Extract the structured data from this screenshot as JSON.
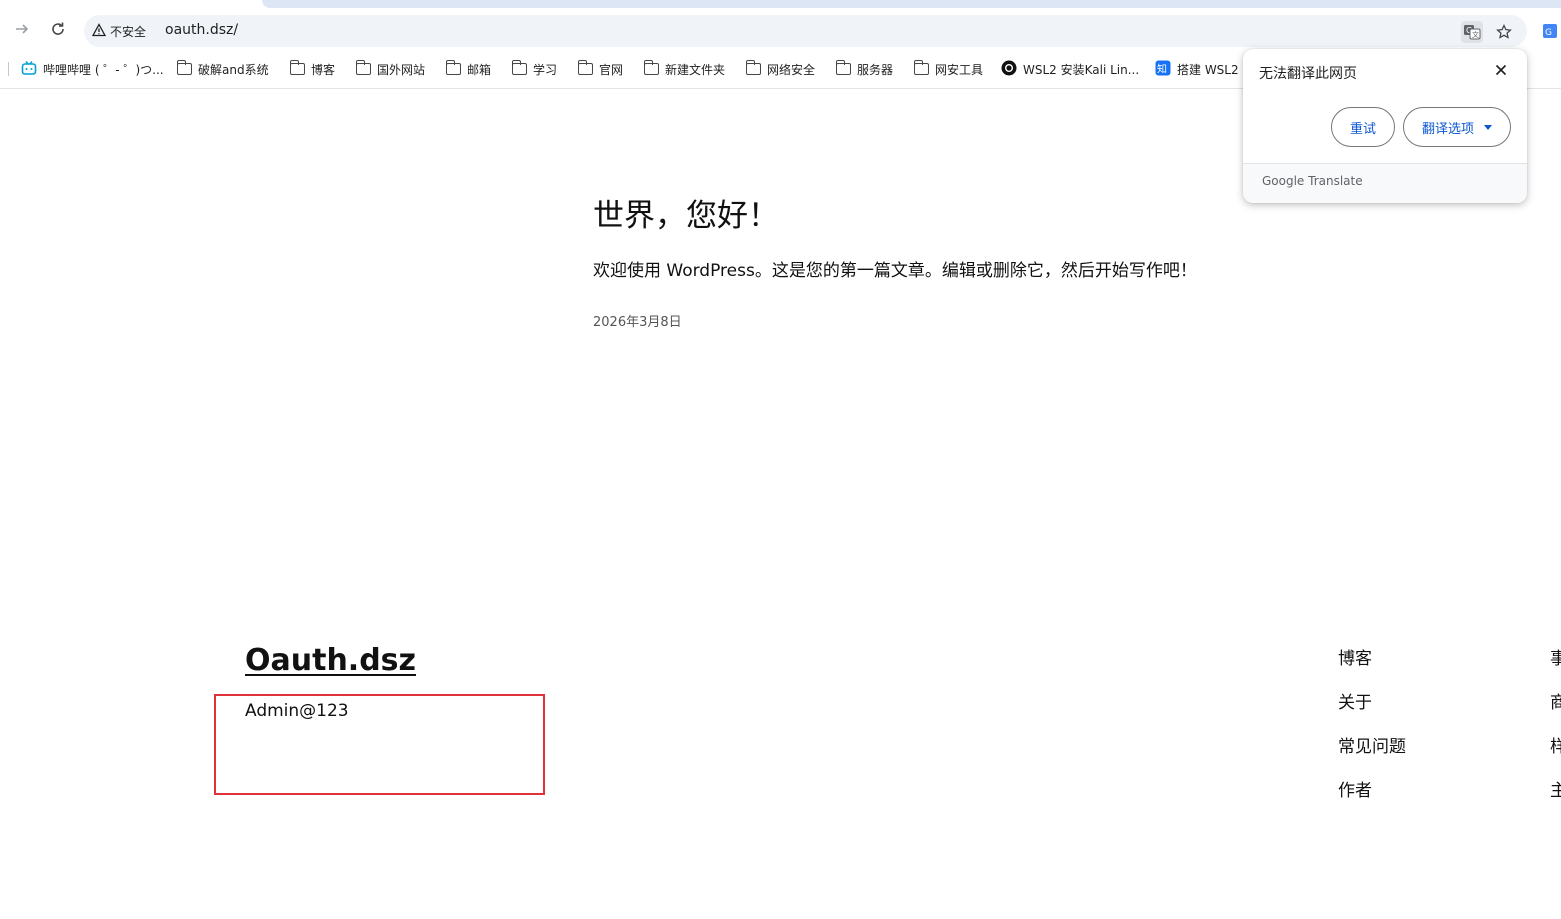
{
  "browser": {
    "security_label": "不安全",
    "url": "oauth.dsz/",
    "icons": {
      "forward": "arrow-right-icon",
      "reload": "reload-icon",
      "warning": "warning-triangle-icon",
      "translate": "translate-icon",
      "star": "star-icon"
    },
    "colors": {
      "omnibox_bg": "#f0f4f9",
      "accent_blue": "#0b57d0"
    }
  },
  "bookmarks": [
    {
      "label": "哔哩哔哩 ( ゜- ゜)つ...",
      "icon": "bilibili-icon"
    },
    {
      "label": "破解and系统",
      "icon": "folder-icon"
    },
    {
      "label": "博客",
      "icon": "folder-icon"
    },
    {
      "label": "国外网站",
      "icon": "folder-icon"
    },
    {
      "label": "邮箱",
      "icon": "folder-icon"
    },
    {
      "label": "学习",
      "icon": "folder-icon"
    },
    {
      "label": "官网",
      "icon": "folder-icon"
    },
    {
      "label": "新建文件夹",
      "icon": "folder-icon"
    },
    {
      "label": "网络安全",
      "icon": "folder-icon"
    },
    {
      "label": "服务器",
      "icon": "folder-icon"
    },
    {
      "label": "网安工具",
      "icon": "folder-icon"
    },
    {
      "label": "WSL2 安装Kali Lin...",
      "icon": "github-icon"
    },
    {
      "label": "搭建 WSL2",
      "icon": "zhihu-icon"
    }
  ],
  "translate_popup": {
    "title": "无法翻译此网页",
    "retry_label": "重试",
    "options_label": "翻译选项",
    "footer": "Google Translate"
  },
  "post": {
    "title": "世界，您好！",
    "excerpt": "欢迎使用 WordPress。这是您的第一篇文章。编辑或删除它，然后开始写作吧！",
    "date": "2026年3月8日"
  },
  "footer": {
    "site_title": "Oauth.dsz",
    "tagline": "Admin@123",
    "highlight_color": "#e0313b",
    "nav_col1": [
      "博客",
      "关于",
      "常见问题",
      "作者"
    ],
    "nav_col2": [
      "事",
      "商",
      "样",
      "主"
    ]
  }
}
